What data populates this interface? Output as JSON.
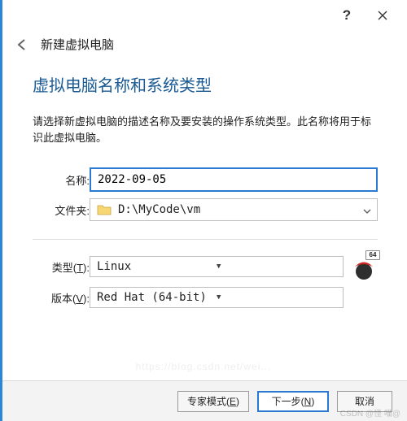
{
  "titlebar": {
    "help": "?",
    "close": "×"
  },
  "crumb": {
    "title": "新建虚拟电脑"
  },
  "heading": "虚拟电脑名称和系统类型",
  "description": "请选择新虚拟电脑的描述名称及要安装的操作系统类型。此名称将用于标识此虚拟电脑。",
  "form": {
    "name": {
      "label": "名称:",
      "value": "2022-09-05"
    },
    "folder": {
      "label": "文件夹:",
      "value": "D:\\MyCode\\vm"
    },
    "type": {
      "label": "类型(T):",
      "label_plain": "类型",
      "hotkey": "T",
      "value": "Linux",
      "badge": "64"
    },
    "version": {
      "label": "版本(V):",
      "label_plain": "版本",
      "hotkey": "V",
      "value": "Red Hat (64-bit)"
    }
  },
  "buttons": {
    "expert": {
      "label": "专家模式(E)",
      "plain": "专家模式",
      "hotkey": "E"
    },
    "next": {
      "label": "下一步(N)",
      "plain": "下一步",
      "hotkey": "N"
    },
    "cancel": {
      "label": "取消"
    }
  },
  "watermark": "CSDN @怪 喵@",
  "watermark_bg": "https://blog.csdn.net/wei..."
}
